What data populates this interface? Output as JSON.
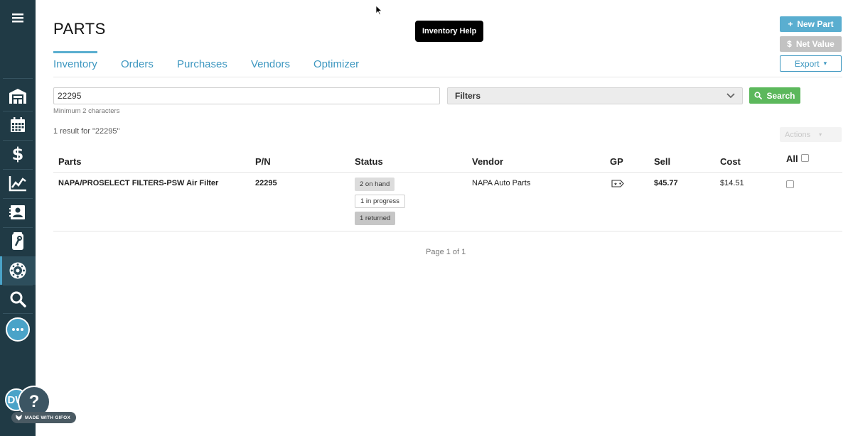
{
  "page": {
    "title": "PARTS"
  },
  "tooltip": {
    "text": "Inventory Help"
  },
  "header_buttons": {
    "new_part": "New Part",
    "new_part_icon": "+",
    "net_value": "Net Value",
    "net_value_icon": "$",
    "export": "Export",
    "export_caret": "▾"
  },
  "tabs": [
    {
      "label": "Inventory",
      "active": true
    },
    {
      "label": "Orders",
      "active": false
    },
    {
      "label": "Purchases",
      "active": false
    },
    {
      "label": "Vendors",
      "active": false
    },
    {
      "label": "Optimizer",
      "active": false
    }
  ],
  "search": {
    "value": "22295",
    "hint": "Minimum 2 characters",
    "filters_label": "Filters",
    "button_label": "Search"
  },
  "results": {
    "summary": "1 result for \"22295\"",
    "actions_label": "Actions",
    "actions_caret": "▾"
  },
  "table": {
    "headers": {
      "parts": "Parts",
      "pn": "P/N",
      "status": "Status",
      "vendor": "Vendor",
      "gp": "GP",
      "sell": "Sell",
      "cost": "Cost",
      "all": "All"
    },
    "rows": [
      {
        "part": "NAPA/PROSELECT FILTERS-PSW Air Filter",
        "pn": "22295",
        "statuses": [
          "2 on hand",
          "1 in progress",
          "1 returned"
        ],
        "vendor": "NAPA Auto Parts",
        "gp_icon": "tag-icon",
        "sell": "$45.77",
        "cost": "$14.51"
      }
    ]
  },
  "pager": {
    "text": "Page 1 of 1"
  },
  "sidebar": {
    "items": [
      {
        "name": "menu-icon"
      },
      {
        "name": "shop-icon"
      },
      {
        "name": "calendar-icon"
      },
      {
        "name": "dollar-icon"
      },
      {
        "name": "chart-icon"
      },
      {
        "name": "contacts-icon"
      },
      {
        "name": "parts-icon"
      },
      {
        "name": "tire-icon",
        "active": true
      },
      {
        "name": "search-icon"
      },
      {
        "name": "chat-icon"
      }
    ],
    "avatar_initials": "DW",
    "help_label": "?",
    "gifox_label": "MADE WITH GIFOX"
  },
  "colors": {
    "sidebar": "#203a45",
    "accent": "#4aa3c8",
    "primary_button": "#5aaed0",
    "search_button": "#5cb85c"
  }
}
